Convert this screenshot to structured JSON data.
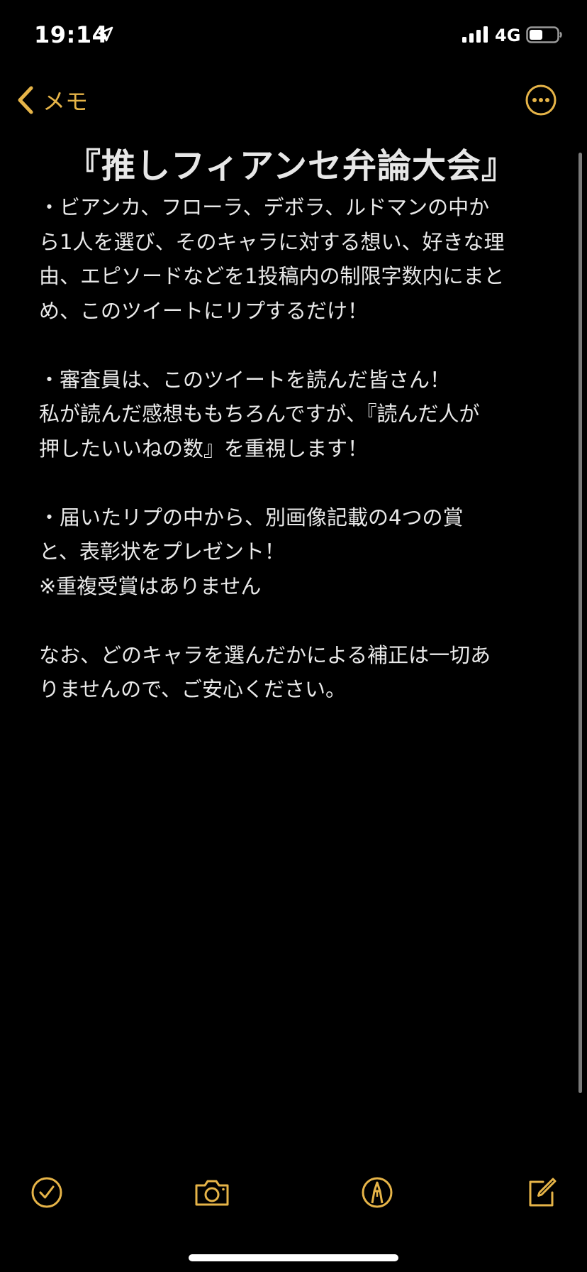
{
  "status_bar": {
    "time": "19:14",
    "network": "4G",
    "icons": [
      "location-arrow-icon",
      "signal-bars-icon",
      "battery-icon"
    ]
  },
  "nav": {
    "back_label": "メモ",
    "back_icon": "chevron-left-icon",
    "more_icon": "ellipsis-circle-icon"
  },
  "note": {
    "title": "『推しフィアンセ弁論大会』",
    "lines": [
      "・ビアンカ、フローラ、デボラ、ルドマンの中か",
      "ら1人を選び、そのキャラに対する想い、好きな理",
      "由、エピソードなどを1投稿内の制限字数内にまと",
      "め、このツイートにリプするだけ！",
      "",
      "・審査員は、このツイートを読んだ皆さん！",
      "私が読んだ感想ももちろんですが、『読んだ人が",
      "押したいいねの数』を重視します！",
      "",
      "・届いたリプの中から、別画像記載の4つの賞",
      "と、表彰状をプレゼント！",
      "※重複受賞はありません",
      "",
      "なお、どのキャラを選んだかによる補正は一切あ",
      "りませんので、ご安心ください。"
    ]
  },
  "toolbar": {
    "icons": [
      "checklist-icon",
      "camera-icon",
      "markup-pen-icon",
      "compose-icon"
    ]
  },
  "colors": {
    "accent": "#e6b448",
    "background": "#000000",
    "text": "#e9e9e9"
  }
}
